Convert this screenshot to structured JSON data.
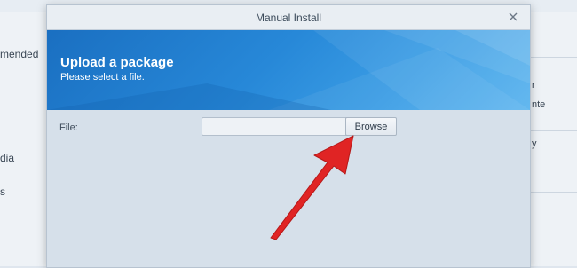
{
  "dialog": {
    "title": "Manual Install",
    "banner_title": "Upload a package",
    "banner_subtitle": "Please select a file.",
    "file_label": "File:",
    "file_value": "",
    "browse_label": "Browse"
  },
  "background": {
    "left_items": [
      "mended",
      "dia",
      "s"
    ],
    "right_items": [
      "r",
      "nte",
      "y"
    ]
  },
  "icons": {
    "close": "close-icon",
    "arrow": "red-arrow-annotation"
  },
  "colors": {
    "banner": "#2788d8",
    "arrow": "#e02424"
  }
}
